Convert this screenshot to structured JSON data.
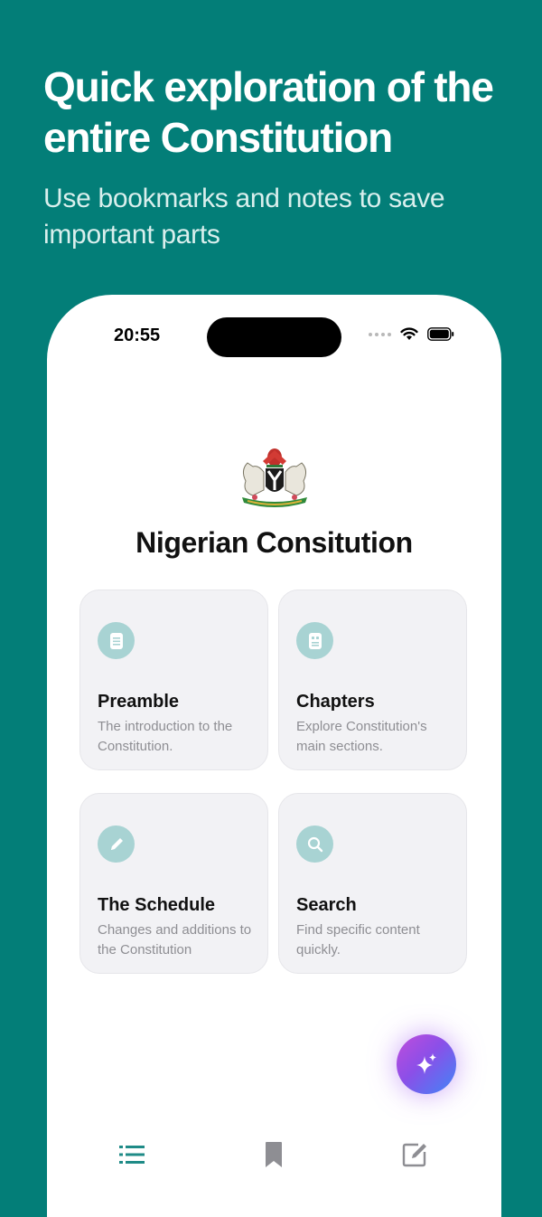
{
  "colors": {
    "background": "#037e78",
    "accent": "#1f8b87",
    "card_icon_bg": "#a8d3d3",
    "fab_gradient": [
      "#c04ddb",
      "#8b4fe8",
      "#3f86f7"
    ]
  },
  "promo": {
    "title": "Quick exploration of the entire Constitution",
    "subtitle": "Use bookmarks and notes to save important parts"
  },
  "status_bar": {
    "time": "20:55",
    "icons": [
      "signal-dots-icon",
      "wifi-icon",
      "battery-icon"
    ]
  },
  "app": {
    "emblem": "nigerian-coat-of-arms",
    "title": "Nigerian Consitution"
  },
  "cards": [
    {
      "title": "Preamble",
      "description": "The introduction to the Constitution.",
      "icon": "document-icon"
    },
    {
      "title": "Chapters",
      "description": "Explore Constitution's main sections.",
      "icon": "sections-icon"
    },
    {
      "title": "The Schedule",
      "description": "Changes and additions to the Constitution",
      "icon": "pencil-icon"
    },
    {
      "title": "Search",
      "description": "Find specific content quickly.",
      "icon": "magnifier-icon"
    }
  ],
  "fab": {
    "icon": "sparkles-icon"
  },
  "tab_bar": {
    "items": [
      {
        "icon": "list-icon",
        "active": true
      },
      {
        "icon": "bookmark-icon",
        "active": false
      },
      {
        "icon": "edit-note-icon",
        "active": false
      }
    ]
  }
}
